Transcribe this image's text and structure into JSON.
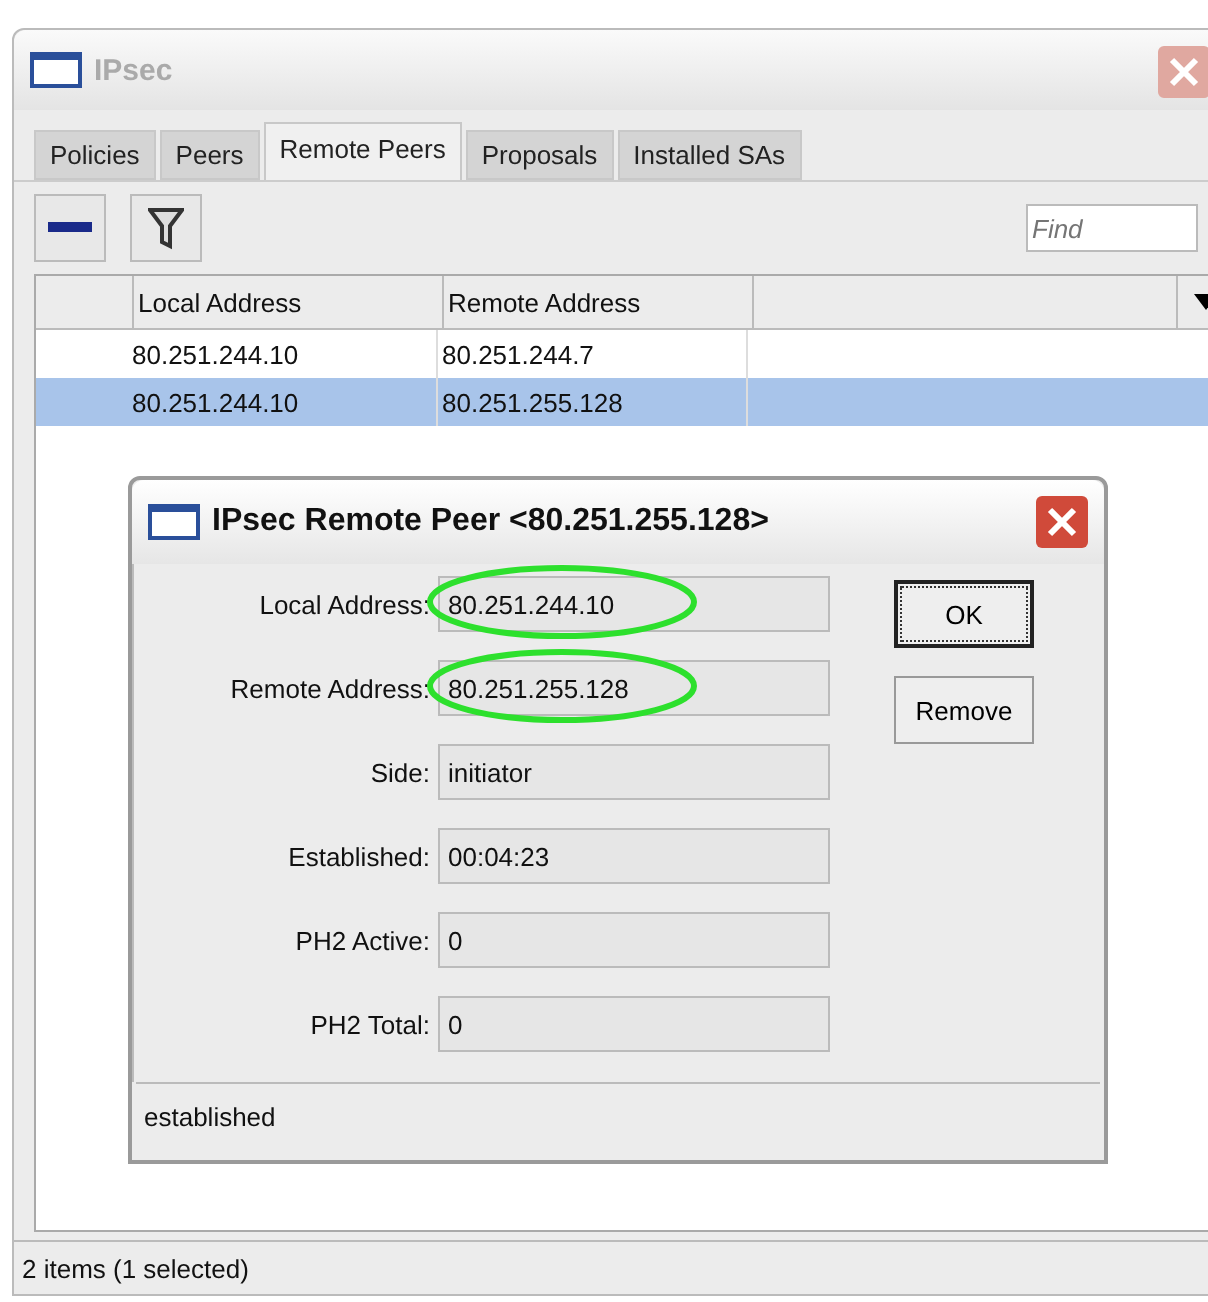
{
  "window": {
    "title": "IPsec"
  },
  "tabs": [
    {
      "label": "Policies",
      "selected": false
    },
    {
      "label": "Peers",
      "selected": false
    },
    {
      "label": "Remote Peers",
      "selected": true
    },
    {
      "label": "Proposals",
      "selected": false
    },
    {
      "label": "Installed SAs",
      "selected": false
    }
  ],
  "search": {
    "placeholder": "Find"
  },
  "table": {
    "columns": [
      "Local Address",
      "Remote Address"
    ],
    "rows": [
      {
        "cells": [
          "80.251.244.10",
          "80.251.244.7"
        ],
        "selected": false
      },
      {
        "cells": [
          "80.251.244.10",
          "80.251.255.128"
        ],
        "selected": true
      }
    ]
  },
  "dialog": {
    "title": "IPsec Remote Peer <80.251.255.128>",
    "fields": [
      {
        "label": "Local Address:",
        "value": "80.251.244.10",
        "highlighted": true
      },
      {
        "label": "Remote Address:",
        "value": "80.251.255.128",
        "highlighted": true
      },
      {
        "label": "Side:",
        "value": "initiator",
        "highlighted": false
      },
      {
        "label": "Established:",
        "value": "00:04:23",
        "highlighted": false
      },
      {
        "label": "PH2 Active:",
        "value": "0",
        "highlighted": false
      },
      {
        "label": "PH2 Total:",
        "value": "0",
        "highlighted": false
      }
    ],
    "buttons": [
      {
        "label": "OK",
        "focused": true
      },
      {
        "label": "Remove",
        "focused": false
      }
    ],
    "status": "established"
  },
  "status_bar": "2 items (1 selected)"
}
